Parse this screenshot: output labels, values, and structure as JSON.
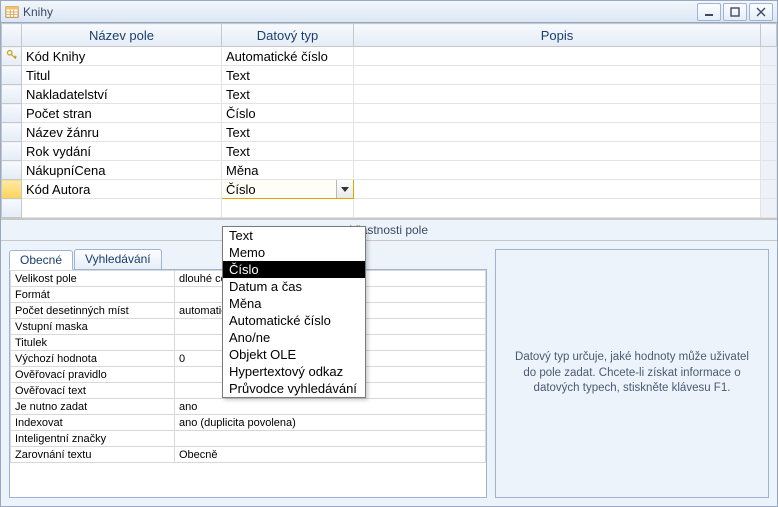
{
  "window": {
    "title": "Knihy"
  },
  "columns": {
    "name": "Název pole",
    "type": "Datový typ",
    "desc": "Popis"
  },
  "fields": [
    {
      "name": "Kód Knihy",
      "type": "Automatické číslo",
      "key": true
    },
    {
      "name": "Titul",
      "type": "Text"
    },
    {
      "name": "Nakladatelství",
      "type": "Text"
    },
    {
      "name": "Počet stran",
      "type": "Číslo"
    },
    {
      "name": "Název žánru",
      "type": "Text"
    },
    {
      "name": "Rok vydání",
      "type": "Text"
    },
    {
      "name": "NákupníCena",
      "type": "Měna"
    },
    {
      "name": "Kód Autora",
      "type": "Číslo",
      "active": true
    }
  ],
  "type_options": [
    "Text",
    "Memo",
    "Číslo",
    "Datum a čas",
    "Měna",
    "Automatické číslo",
    "Ano/ne",
    "Objekt OLE",
    "Hypertextový odkaz",
    "Průvodce vyhledávání"
  ],
  "type_selected": "Číslo",
  "section_label": "Vlastnosti pole",
  "tabs": {
    "general": "Obecné",
    "lookup": "Vyhledávání"
  },
  "properties": [
    {
      "n": "Velikost pole",
      "v": "dlouhé celé číslo"
    },
    {
      "n": "Formát",
      "v": ""
    },
    {
      "n": "Počet desetinných míst",
      "v": "automatický"
    },
    {
      "n": "Vstupní maska",
      "v": ""
    },
    {
      "n": "Titulek",
      "v": ""
    },
    {
      "n": "Výchozí hodnota",
      "v": "0"
    },
    {
      "n": "Ověřovací pravidlo",
      "v": ""
    },
    {
      "n": "Ověřovací text",
      "v": ""
    },
    {
      "n": "Je nutno zadat",
      "v": "ano"
    },
    {
      "n": "Indexovat",
      "v": "ano (duplicita povolena)"
    },
    {
      "n": "Inteligentní značky",
      "v": ""
    },
    {
      "n": "Zarovnání textu",
      "v": "Obecně"
    }
  ],
  "help_text": "Datový typ určuje, jaké hodnoty může uživatel do pole zadat. Chcete-li získat informace o datových typech, stiskněte klávesu F1."
}
